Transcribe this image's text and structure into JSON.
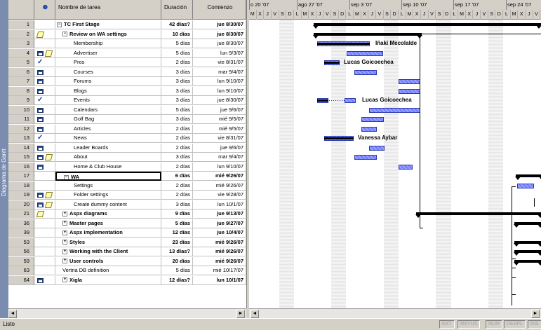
{
  "sidebar": {
    "label": "Diagrama de Gantt"
  },
  "table": {
    "headers": {
      "indicator": "❶",
      "name": "Nombre de tarea",
      "duration": "Duración",
      "start": "Comienzo"
    },
    "rows": [
      {
        "id": "1",
        "indicators": [],
        "name": "TC First Stage",
        "duration": "42 días?",
        "start": "jue 8/30/07",
        "bold": true,
        "level": 0,
        "toggle": "−"
      },
      {
        "id": "2",
        "indicators": [
          "note-icon"
        ],
        "name": "Review on WA settings",
        "duration": "10 días",
        "start": "jue 8/30/07",
        "bold": true,
        "level": 1,
        "toggle": "−"
      },
      {
        "id": "3",
        "indicators": [],
        "name": "Membership",
        "duration": "5 días",
        "start": "jue 8/30/07",
        "bold": false,
        "level": 2
      },
      {
        "id": "4",
        "indicators": [
          "calendar-icon",
          "note-icon"
        ],
        "name": "Advertiser",
        "duration": "5 días",
        "start": "lun 9/3/07",
        "bold": false,
        "level": 2
      },
      {
        "id": "5",
        "indicators": [
          "check-icon"
        ],
        "name": "Pros",
        "duration": "2 días",
        "start": "vie 8/31/07",
        "bold": false,
        "level": 2
      },
      {
        "id": "6",
        "indicators": [
          "calendar-icon"
        ],
        "name": "Courses",
        "duration": "3 días",
        "start": "mar 9/4/07",
        "bold": false,
        "level": 2
      },
      {
        "id": "7",
        "indicators": [
          "calendar-icon"
        ],
        "name": "Forums",
        "duration": "3 días",
        "start": "lun 9/10/07",
        "bold": false,
        "level": 2
      },
      {
        "id": "8",
        "indicators": [
          "calendar-icon"
        ],
        "name": "Blogs",
        "duration": "3 días",
        "start": "lun 9/10/07",
        "bold": false,
        "level": 2
      },
      {
        "id": "9",
        "indicators": [
          "check-icon"
        ],
        "name": "Events",
        "duration": "3 días",
        "start": "jue 8/30/07",
        "bold": false,
        "level": 2
      },
      {
        "id": "10",
        "indicators": [
          "calendar-icon"
        ],
        "name": "Calendars",
        "duration": "5 días",
        "start": "jue 9/6/07",
        "bold": false,
        "level": 2
      },
      {
        "id": "11",
        "indicators": [
          "calendar-icon"
        ],
        "name": "Golf Bag",
        "duration": "3 días",
        "start": "mié 9/5/07",
        "bold": false,
        "level": 2
      },
      {
        "id": "12",
        "indicators": [
          "calendar-icon"
        ],
        "name": "Articles",
        "duration": "2 días",
        "start": "mié 9/5/07",
        "bold": false,
        "level": 2
      },
      {
        "id": "13",
        "indicators": [
          "check-icon"
        ],
        "name": "News",
        "duration": "2 días",
        "start": "vie 8/31/07",
        "bold": false,
        "level": 2
      },
      {
        "id": "14",
        "indicators": [
          "calendar-icon"
        ],
        "name": "Leader Boards",
        "duration": "2 días",
        "start": "jue 9/6/07",
        "bold": false,
        "level": 2
      },
      {
        "id": "15",
        "indicators": [
          "calendar-icon",
          "note-icon"
        ],
        "name": "About",
        "duration": "3 días",
        "start": "mar 9/4/07",
        "bold": false,
        "level": 2
      },
      {
        "id": "16",
        "indicators": [
          "calendar-icon"
        ],
        "name": "Home & Club House",
        "duration": "2 días",
        "start": "lun 9/10/07",
        "bold": false,
        "level": 2
      },
      {
        "id": "17",
        "indicators": [],
        "name": "WA",
        "duration": "6 días",
        "start": "mié 9/26/07",
        "bold": true,
        "level": 1,
        "toggle": "−",
        "selected": true
      },
      {
        "id": "18",
        "indicators": [],
        "name": "Settings",
        "duration": "2 días",
        "start": "mié 9/26/07",
        "bold": false,
        "level": 2
      },
      {
        "id": "19",
        "indicators": [
          "calendar-icon",
          "note-icon"
        ],
        "name": "Folder settings",
        "duration": "2 días",
        "start": "vie 9/28/07",
        "bold": false,
        "level": 2
      },
      {
        "id": "20",
        "indicators": [
          "calendar-icon",
          "note-icon"
        ],
        "name": "Create dummy content",
        "duration": "3 días",
        "start": "lun 10/1/07",
        "bold": false,
        "level": 2
      },
      {
        "id": "21",
        "indicators": [
          "note-icon"
        ],
        "name": "Aspx diagrams",
        "duration": "9 días",
        "start": "jue 9/13/07",
        "bold": true,
        "level": 1,
        "toggle": "+"
      },
      {
        "id": "36",
        "indicators": [],
        "name": "Master pages",
        "duration": "5 días",
        "start": "jue 9/27/07",
        "bold": true,
        "level": 1,
        "toggle": "+"
      },
      {
        "id": "39",
        "indicators": [],
        "name": "Aspx implementation",
        "duration": "12 días",
        "start": "jue 10/4/07",
        "bold": true,
        "level": 1,
        "toggle": "+"
      },
      {
        "id": "53",
        "indicators": [],
        "name": "Styles",
        "duration": "23 días",
        "start": "mié 9/26/07",
        "bold": true,
        "level": 1,
        "toggle": "+"
      },
      {
        "id": "56",
        "indicators": [],
        "name": "Working with the Client",
        "duration": "13 días?",
        "start": "mié 9/26/07",
        "bold": true,
        "level": 1,
        "toggle": "+"
      },
      {
        "id": "59",
        "indicators": [],
        "name": "User controls",
        "duration": "20 días",
        "start": "mié 9/26/07",
        "bold": true,
        "level": 1,
        "toggle": "+"
      },
      {
        "id": "63",
        "indicators": [],
        "name": "Vertria DB definition",
        "duration": "5 días",
        "start": "mié 10/17/07",
        "bold": false,
        "level": 1
      },
      {
        "id": "64",
        "indicators": [
          "calendar-icon"
        ],
        "name": "Xigla",
        "duration": "12 días?",
        "start": "lun 10/1/07",
        "bold": true,
        "level": 1,
        "toggle": "+"
      }
    ]
  },
  "gantt": {
    "weeks": [
      "o 20 '07",
      "ago 27 '07",
      "sep 3 '07",
      "sep 10 '07",
      "sep 17 '07",
      "sep 24 '07"
    ],
    "day_letters": [
      "M",
      "X",
      "J",
      "V",
      "S",
      "D",
      "L",
      "M",
      "X",
      "J",
      "V",
      "S",
      "D",
      "L",
      "M",
      "X",
      "J",
      "V",
      "S",
      "D",
      "L",
      "M",
      "X",
      "J",
      "V",
      "S",
      "D",
      "L",
      "M",
      "X",
      "J",
      "V",
      "S",
      "D",
      "L",
      "M",
      "X",
      "J",
      "V"
    ],
    "resources": {
      "membership": "Iñaki Mecolalde",
      "pros": "Lucas Goicoechea",
      "events": "Lucas Goicoechea",
      "news": "Vanessa Aybar"
    }
  },
  "statusbar": {
    "text": "Listo",
    "indicators": [
      "EXT",
      "MAYÚS",
      "NUM",
      "DESPL",
      "INS"
    ]
  },
  "scroll": {
    "left": "◄",
    "right": "►"
  }
}
